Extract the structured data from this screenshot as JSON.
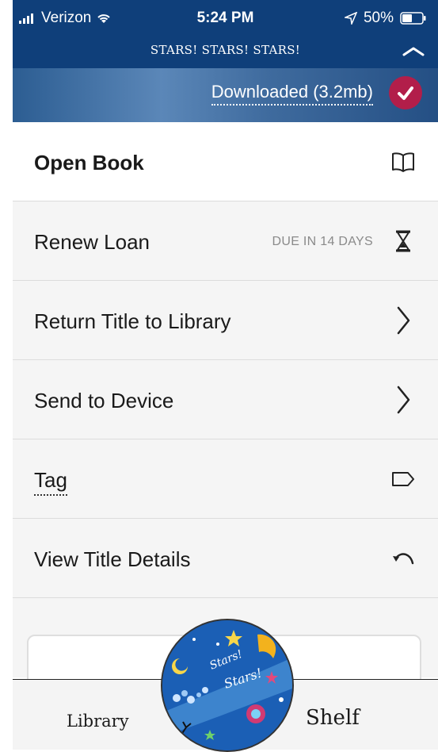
{
  "status_bar": {
    "carrier": "Verizon",
    "time": "5:24 PM",
    "battery": "50%"
  },
  "header": {
    "title": "STARS! STARS! STARS!"
  },
  "download": {
    "label": "Downloaded (3.2mb)"
  },
  "menu": {
    "items": [
      {
        "label": "Open Book",
        "icon": "book-icon"
      },
      {
        "label": "Renew Loan",
        "sub": "DUE IN 14 DAYS",
        "icon": "hourglass-icon"
      },
      {
        "label": "Return Title to Library",
        "icon": "chevron-right-icon"
      },
      {
        "label": "Send to Device",
        "icon": "chevron-right-icon"
      },
      {
        "label": "Tag",
        "icon": "tag-icon"
      },
      {
        "label": "View Title Details",
        "icon": "undo-arrow-icon"
      }
    ]
  },
  "tabs": {
    "library": "Library",
    "shelf": "Shelf"
  },
  "cover": {
    "text_1": "Stars!",
    "text_2": "Stars!"
  },
  "colors": {
    "header_bg": "#0f3f7a",
    "accent": "#b21e4a"
  }
}
